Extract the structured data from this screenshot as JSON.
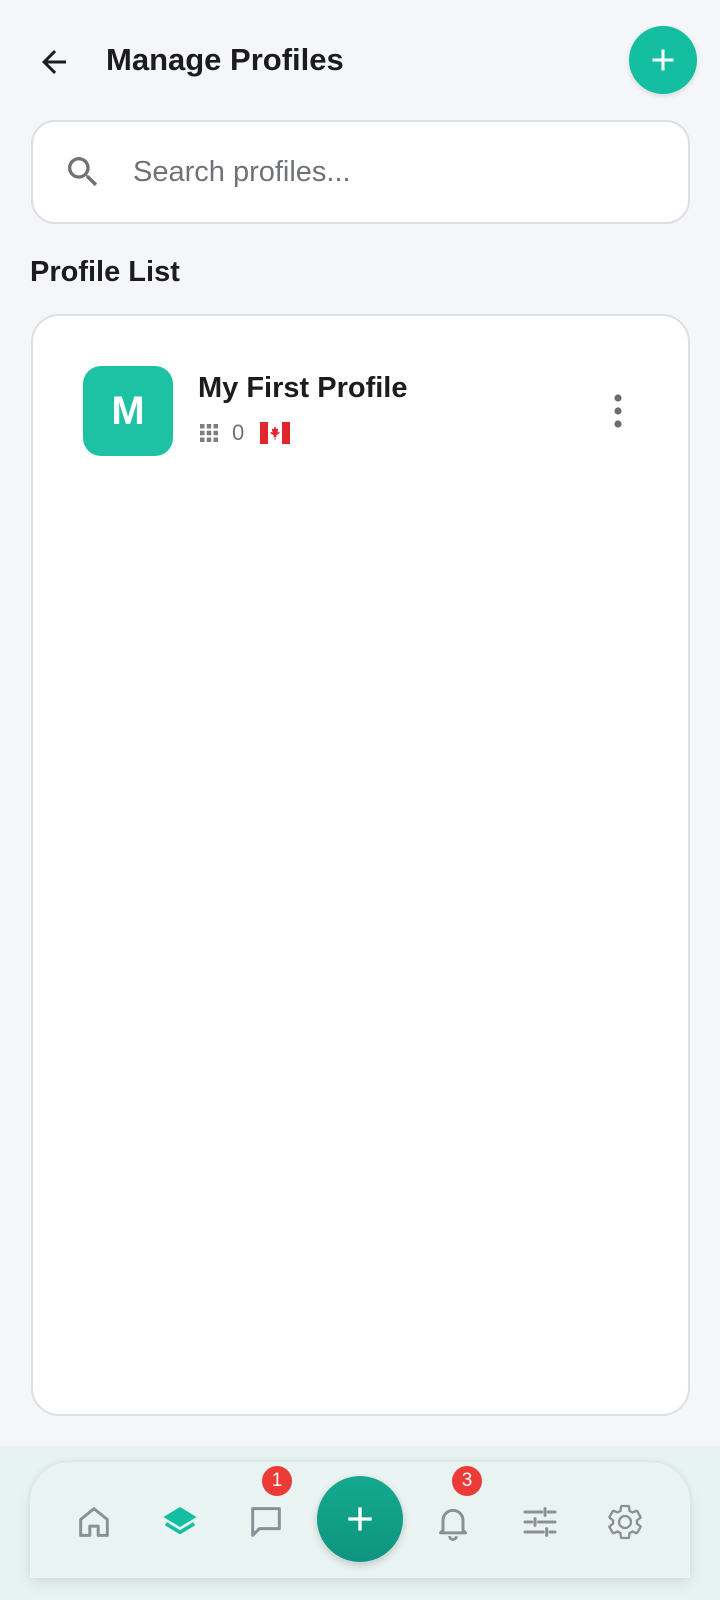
{
  "header": {
    "title": "Manage Profiles",
    "back_icon": "arrow-left-icon",
    "add_icon": "plus-icon"
  },
  "search": {
    "placeholder": "Search profiles...",
    "value": "",
    "icon": "search-icon"
  },
  "profile_list": {
    "title": "Profile List",
    "items": [
      {
        "initial": "M",
        "name": "My First Profile",
        "count": "0",
        "count_icon": "grid-icon",
        "flag": "canada-flag-icon",
        "menu_icon": "more-vertical-icon"
      }
    ]
  },
  "bottom_nav": {
    "items": [
      {
        "icon": "home-icon",
        "active": false
      },
      {
        "icon": "layers-icon",
        "active": true
      },
      {
        "icon": "chat-icon",
        "badge": "1",
        "active": false
      },
      {
        "icon": "plus-icon",
        "fab": true
      },
      {
        "icon": "bell-icon",
        "badge": "3",
        "active": false
      },
      {
        "icon": "sliders-icon",
        "active": false
      },
      {
        "icon": "gear-icon",
        "active": false
      }
    ]
  },
  "colors": {
    "accent": "#14bfa1",
    "fab_dark": "#0f9480",
    "badge": "#ec3b37",
    "background": "#f4f6f9",
    "nav_background": "#e9f4f2"
  }
}
